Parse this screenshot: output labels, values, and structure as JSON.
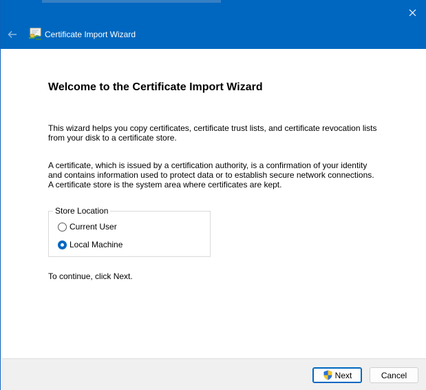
{
  "window": {
    "title": "Certificate Import Wizard",
    "accent_color": "#0067c0",
    "close_icon": "close-icon",
    "back_icon": "back-arrow-icon",
    "wizard_icon": "certificate-icon"
  },
  "main": {
    "heading": "Welcome to the Certificate Import Wizard",
    "paragraph1_line1": "This wizard helps you copy certificates, certificate trust lists, and certificate revocation lists",
    "paragraph1_line2": "from your disk to a certificate store.",
    "paragraph2_line1": "A certificate, which is issued by a certification authority, is a confirmation of your identity",
    "paragraph2_line2": "and contains information used to protect data or to establish secure network connections.",
    "paragraph2_line3": "A certificate store is the system area where certificates are kept.",
    "store_location": {
      "legend": "Store Location",
      "options": [
        {
          "label": "Current User",
          "selected": false
        },
        {
          "label": "Local Machine",
          "selected": true
        }
      ]
    },
    "continue_text": "To continue, click Next."
  },
  "footer": {
    "next_label": "Next",
    "next_icon": "uac-shield-icon",
    "cancel_label": "Cancel"
  }
}
